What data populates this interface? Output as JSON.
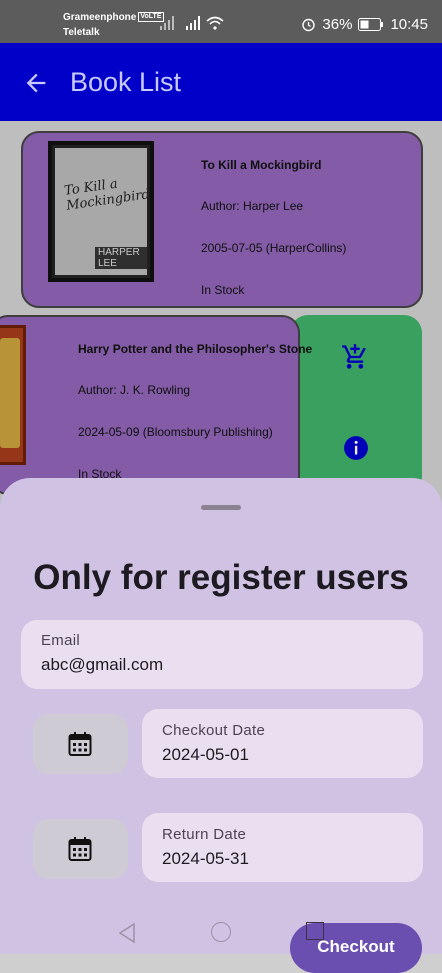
{
  "status_bar": {
    "carrier_1": "Grameenphone",
    "volte": "VoLTE",
    "carrier_2": "Teletalk",
    "battery": "36%",
    "time": "10:45"
  },
  "app_bar": {
    "title": "Book List",
    "color": "#0000c8"
  },
  "books": [
    {
      "title": "To Kill a Mockingbird",
      "author": "Author: Harper Lee",
      "published": "2005-07-05 (HarperCollins)",
      "stock": "In Stock",
      "cover_text": "To Kill a Mockingbird",
      "cover_author": "HARPER LEE"
    },
    {
      "title": "Harry Potter and the Philosopher's Stone",
      "author": "Author: J. K. Rowling",
      "published": "2024-05-09 (Bloomsbury Publishing)",
      "stock": "In Stock"
    }
  ],
  "actions": {
    "icons": [
      "add-to-cart-icon",
      "info-icon"
    ],
    "panel_color": "#3fae68"
  },
  "sheet": {
    "title": "Only for register users",
    "email": {
      "label": "Email",
      "value": "abc@gmail.com"
    },
    "checkout_date": {
      "label": "Checkout Date",
      "value": "2024-05-01"
    },
    "return_date": {
      "label": "Return Date",
      "value": "2024-05-31"
    },
    "checkout_button": "Checkout",
    "accent": "#6b4fb0"
  }
}
